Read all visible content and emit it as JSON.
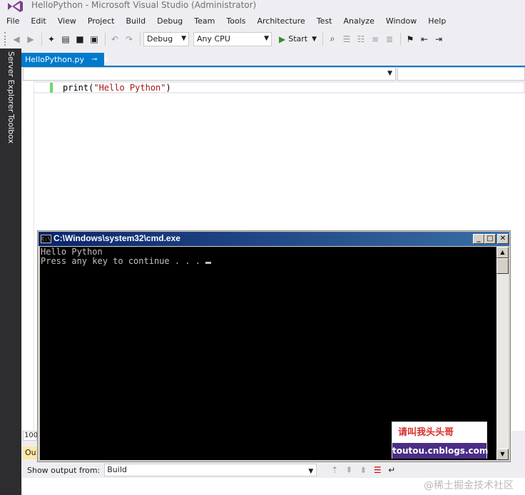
{
  "window": {
    "title": "HelloPython - Microsoft Visual Studio (Administrator)"
  },
  "menu": [
    "File",
    "Edit",
    "View",
    "Project",
    "Build",
    "Debug",
    "Team",
    "Tools",
    "Architecture",
    "Test",
    "Analyze",
    "Window",
    "Help"
  ],
  "toolbar": {
    "configuration": "Debug",
    "platform": "Any CPU",
    "start_label": "Start"
  },
  "left_rail": {
    "server_explorer": "Server Explorer",
    "toolbox": "Toolbox"
  },
  "document_tab": {
    "label": "HelloPython.py",
    "pin": "⊸",
    "close": "✕"
  },
  "editor": {
    "code_prefix": "print(",
    "code_string": "\"Hello Python\"",
    "code_suffix": ")"
  },
  "bottom": {
    "zoom": "100",
    "output_tab": "Ou",
    "show_output_label": "Show output from:",
    "output_source": "Build"
  },
  "cmd": {
    "title": "C:\\Windows\\system32\\cmd.exe",
    "icon_text": "C:\\",
    "lines": [
      "Hello Python",
      "Press any key to continue . . . "
    ],
    "btn_min": "_",
    "btn_max": "□",
    "btn_close": "✕"
  },
  "stamp": {
    "line1": "请叫我头头哥",
    "line2": "toutou.cnblogs.com"
  },
  "corner_watermark": "@稀土掘金技术社区",
  "colors": {
    "accent": "#007acc",
    "play": "#388a34",
    "string": "#a31515",
    "rail": "#2d2d30"
  }
}
